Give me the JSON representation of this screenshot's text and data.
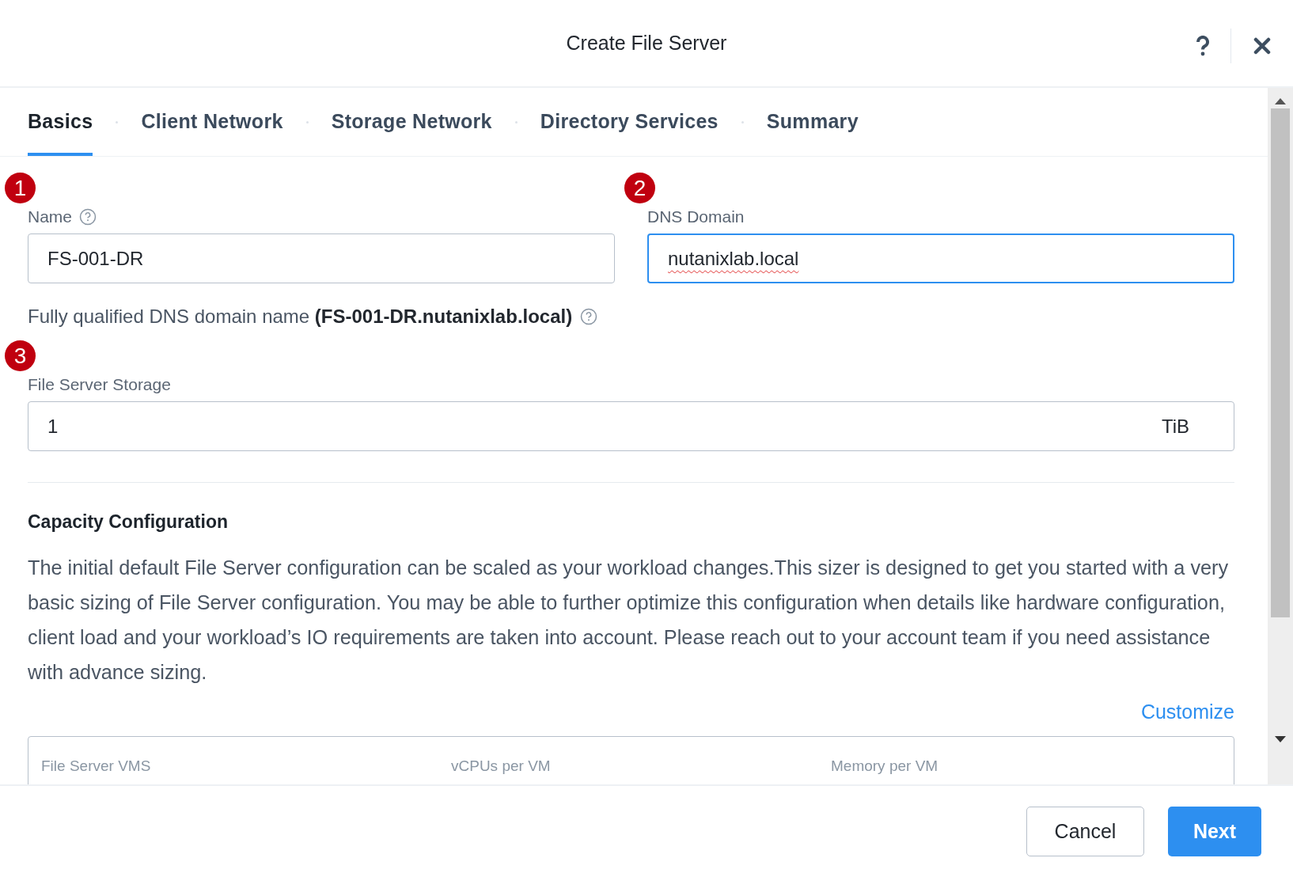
{
  "dialog": {
    "title": "Create File Server"
  },
  "tabs": [
    {
      "label": "Basics",
      "selected": true
    },
    {
      "label": "Client Network",
      "selected": false
    },
    {
      "label": "Storage Network",
      "selected": false
    },
    {
      "label": "Directory Services",
      "selected": false
    },
    {
      "label": "Summary",
      "selected": false
    }
  ],
  "fields": [
    {
      "label": "Name",
      "marker": "1",
      "help": true,
      "value": "FS-001-DR",
      "focused": false,
      "spellcheck_error": false
    },
    {
      "label": "DNS Domain",
      "marker": "2",
      "help": false,
      "value": "nutanixlab.local",
      "focused": true,
      "spellcheck_error": true
    }
  ],
  "fqdn_note": "Fully qualified DNS domain name **(FS-001-DR.nutanixlab.local)**",
  "storage": {
    "label": "File Server Storage",
    "marker": "3",
    "value": "1",
    "unit": "TiB"
  },
  "capacity": {
    "heading": "Capacity Configuration",
    "description": "The initial default File Server configuration can be scaled as your workload changes.This sizer is designed to get you started with a very basic sizing of File Server configuration. You may be able to further optimize this configuration when details like hardware configuration, client load and your workload’s IO requirements are taken into account. Please reach out to your account team if you need assistance with advance sizing.",
    "link": "Customize",
    "table_columns": [
      "File Server VMS",
      "vCPUs per VM",
      "Memory per VM"
    ]
  },
  "buttons": [
    {
      "label": "Cancel",
      "kind": "secondary"
    },
    {
      "label": "Next",
      "kind": "primary"
    }
  ]
}
